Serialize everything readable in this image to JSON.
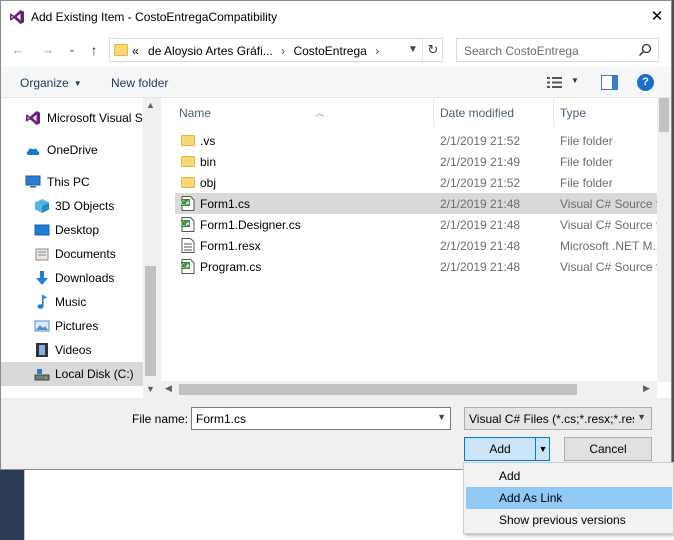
{
  "window": {
    "title": "Add Existing Item - CostoEntregaCompatibility",
    "close_glyph": "✕"
  },
  "nav": {
    "back_glyph": "←",
    "forward_glyph": "→",
    "recent_glyph": "⌄",
    "up_glyph": "↑",
    "breadcrumb": [
      "«",
      "de Aloysio Artes Gráfi...",
      "›",
      "CostoEntrega",
      "›"
    ],
    "refresh_glyph": "↻",
    "search_placeholder": "Search CostoEntrega"
  },
  "toolbar": {
    "organize_label": "Organize",
    "new_folder_label": "New folder",
    "help_label": "?"
  },
  "sidebar": {
    "items": [
      {
        "label": "Microsoft Visual S",
        "icon": "visual-studio-icon"
      },
      {
        "label": "OneDrive",
        "icon": "cloud-icon"
      },
      {
        "label": "This PC",
        "icon": "computer-icon"
      },
      {
        "label": "3D Objects",
        "icon": "cube-icon"
      },
      {
        "label": "Desktop",
        "icon": "desktop-icon"
      },
      {
        "label": "Documents",
        "icon": "documents-icon"
      },
      {
        "label": "Downloads",
        "icon": "download-icon"
      },
      {
        "label": "Music",
        "icon": "music-icon"
      },
      {
        "label": "Pictures",
        "icon": "pictures-icon"
      },
      {
        "label": "Videos",
        "icon": "videos-icon"
      },
      {
        "label": "Local Disk (C:)",
        "icon": "drive-icon"
      }
    ]
  },
  "files": {
    "columns": [
      "Name",
      "Date modified",
      "Type"
    ],
    "rows": [
      {
        "name": ".vs",
        "date": "2/1/2019 21:52",
        "type": "File folder",
        "icon": "folder-icon"
      },
      {
        "name": "bin",
        "date": "2/1/2019 21:49",
        "type": "File folder",
        "icon": "folder-icon"
      },
      {
        "name": "obj",
        "date": "2/1/2019 21:52",
        "type": "File folder",
        "icon": "folder-icon"
      },
      {
        "name": "Form1.cs",
        "date": "2/1/2019 21:48",
        "type": "Visual C# Source f...",
        "icon": "csharp-file-icon"
      },
      {
        "name": "Form1.Designer.cs",
        "date": "2/1/2019 21:48",
        "type": "Visual C# Source f...",
        "icon": "csharp-file-icon"
      },
      {
        "name": "Form1.resx",
        "date": "2/1/2019 21:48",
        "type": "Microsoft .NET M...",
        "icon": "resx-file-icon"
      },
      {
        "name": "Program.cs",
        "date": "2/1/2019 21:48",
        "type": "Visual C# Source f...",
        "icon": "csharp-file-icon"
      }
    ]
  },
  "footer": {
    "file_name_label": "File name:",
    "file_name_value": "Form1.cs",
    "filter_value": "Visual C# Files (*.cs;*.resx;*.resw",
    "add_label": "Add",
    "cancel_label": "Cancel"
  },
  "add_menu": {
    "items": [
      "Add",
      "Add As Link",
      "Show previous versions"
    ]
  },
  "colors": {
    "accent": "#0078d7",
    "selection": "#cce8ff",
    "menu_hover": "#91c9f7",
    "folder": "#f8d775"
  }
}
